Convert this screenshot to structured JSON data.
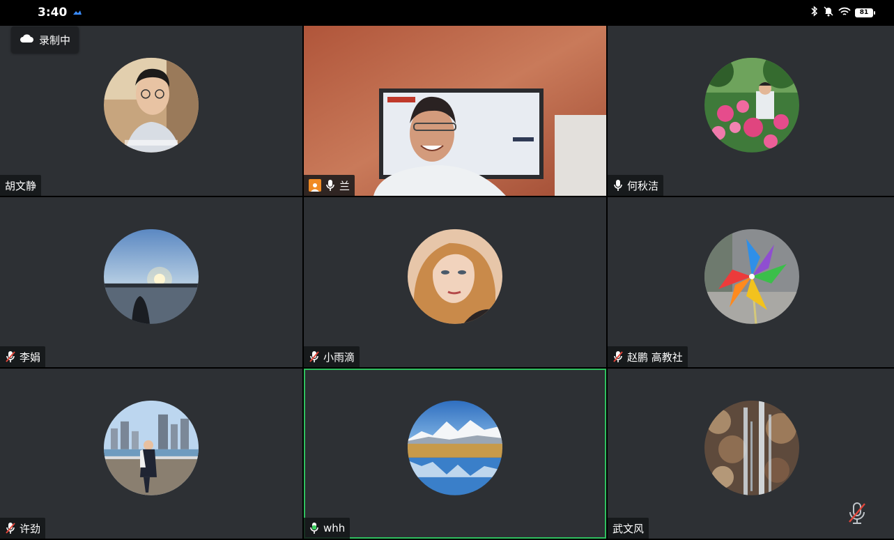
{
  "status_bar": {
    "time": "3:40",
    "battery": "81"
  },
  "recording": {
    "label": "录制中"
  },
  "participants": [
    {
      "name": "胡文静",
      "mic": "none"
    },
    {
      "name": "兰",
      "mic": "on",
      "host": true
    },
    {
      "name": "何秋洁",
      "mic": "on"
    },
    {
      "name": "李娟",
      "mic": "muted"
    },
    {
      "name": "小雨滴",
      "mic": "muted"
    },
    {
      "name": "赵鹏 高教社",
      "mic": "muted"
    },
    {
      "name": "许劲",
      "mic": "muted"
    },
    {
      "name": "whh",
      "mic": "speaking"
    },
    {
      "name": "武文风",
      "mic": "none"
    }
  ],
  "colors": {
    "tile_bg": "#2d3034",
    "active_border": "#2fbf5f",
    "host_badge": "#f08a24",
    "muted_red": "#e0453a"
  }
}
